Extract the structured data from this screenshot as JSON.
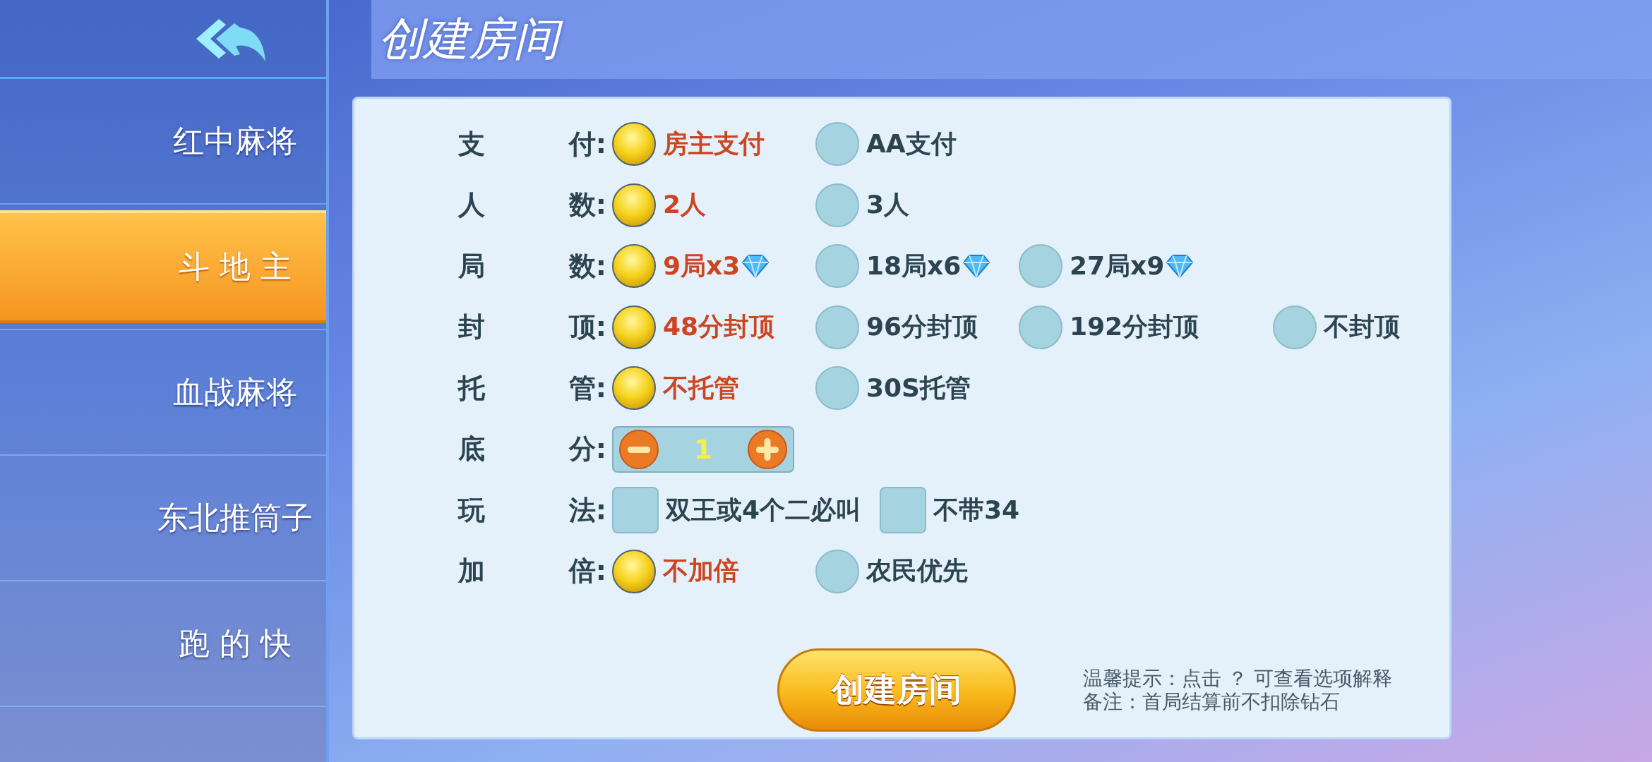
{
  "title": "创建房间",
  "sidebar": {
    "items": [
      {
        "label": "红中麻将",
        "selected": false
      },
      {
        "label": "斗 地 主",
        "selected": true
      },
      {
        "label": "血战麻将",
        "selected": false
      },
      {
        "label": "东北推筒子",
        "selected": false
      },
      {
        "label": "跑 的 快",
        "selected": false
      }
    ]
  },
  "rows": [
    {
      "kind": "radio",
      "label": [
        "支",
        "付:"
      ],
      "options": [
        {
          "text": "房主支付",
          "selected": true
        },
        {
          "text": "AA支付",
          "selected": false
        }
      ]
    },
    {
      "kind": "radio",
      "label": [
        "人",
        "数:"
      ],
      "options": [
        {
          "text": "2人",
          "selected": true
        },
        {
          "text": "3人",
          "selected": false
        }
      ]
    },
    {
      "kind": "radio",
      "label": [
        "局",
        "数:"
      ],
      "options": [
        {
          "text": "9局x3",
          "selected": true,
          "diamond": true
        },
        {
          "text": "18局x6",
          "selected": false,
          "diamond": true
        },
        {
          "text": "27局x9",
          "selected": false,
          "diamond": true
        }
      ]
    },
    {
      "kind": "radio",
      "label": [
        "封",
        "顶:"
      ],
      "options": [
        {
          "text": "48分封顶",
          "selected": true
        },
        {
          "text": "96分封顶",
          "selected": false
        },
        {
          "text": "192分封顶",
          "selected": false
        },
        {
          "text": "不封顶",
          "selected": false
        }
      ]
    },
    {
      "kind": "radio",
      "label": [
        "托",
        "管:"
      ],
      "options": [
        {
          "text": "不托管",
          "selected": true
        },
        {
          "text": "30S托管",
          "selected": false
        }
      ]
    },
    {
      "kind": "stepper",
      "label": [
        "底",
        "分:"
      ],
      "value": "1"
    },
    {
      "kind": "checkbox",
      "label": [
        "玩",
        "法:"
      ],
      "options": [
        {
          "text": "双王或4个二必叫",
          "checked": false
        },
        {
          "text": "不带34",
          "checked": false
        }
      ]
    },
    {
      "kind": "radio",
      "label": [
        "加",
        "倍:"
      ],
      "options": [
        {
          "text": "不加倍",
          "selected": true
        },
        {
          "text": "农民优先",
          "selected": false
        }
      ]
    }
  ],
  "create_button": "创建房间",
  "hints": [
    "温馨提示：点击 ？  可查看选项解释",
    "备注：首局结算前不扣除钻石"
  ]
}
